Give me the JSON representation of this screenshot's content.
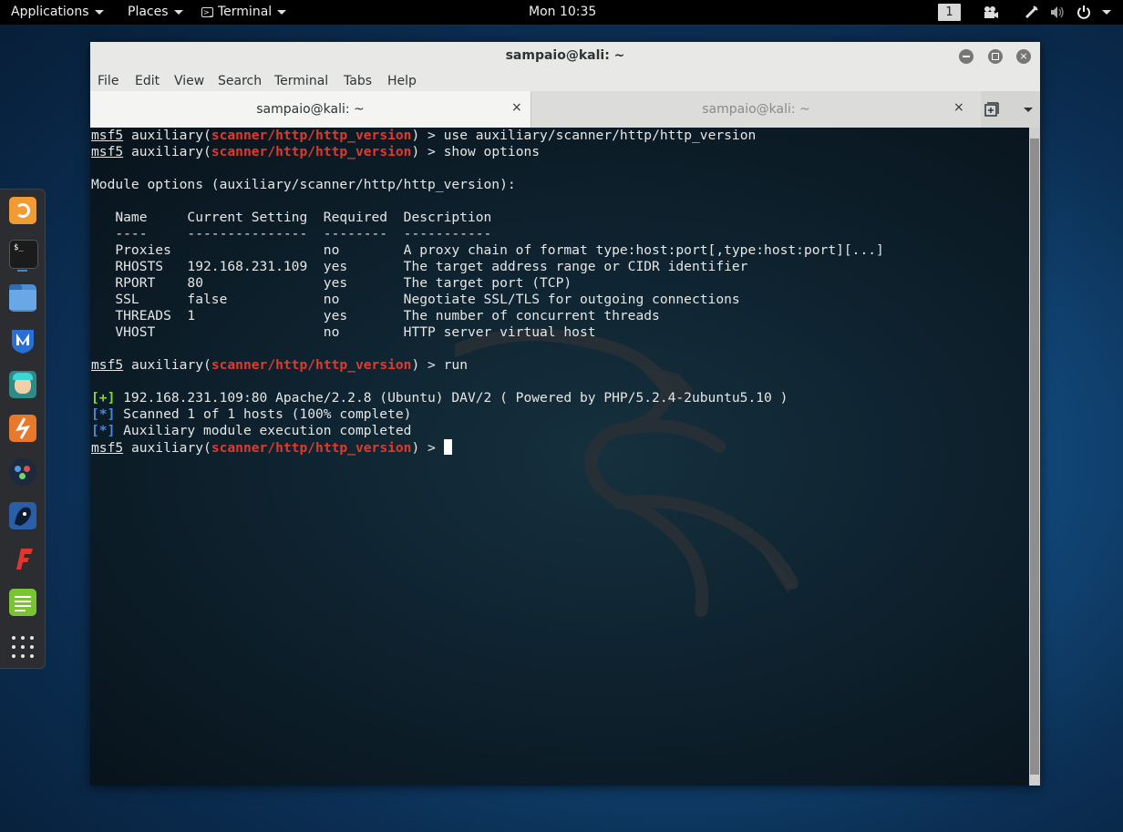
{
  "topbar": {
    "applications": "Applications",
    "places": "Places",
    "terminal": "Terminal",
    "clock": "Mon 10:35",
    "workspace": "1",
    "tray_icons": [
      "camera-icon",
      "pen-icon",
      "volume-icon",
      "power-icon"
    ]
  },
  "dock": {
    "apps": [
      "firefox-icon",
      "terminal-icon",
      "files-icon",
      "metasploit-icon",
      "armitage-icon",
      "burpsuite-icon",
      "maltego-icon",
      "beef-icon",
      "faraday-icon",
      "leafpad-icon",
      "show-apps-icon"
    ]
  },
  "window": {
    "title": "sampaio@kali: ~",
    "menu": [
      "File",
      "Edit",
      "View",
      "Search",
      "Terminal",
      "Tabs",
      "Help"
    ],
    "tabs": [
      {
        "label": "sampaio@kali: ~",
        "close": "×"
      },
      {
        "label": "sampaio@kali: ~",
        "close": "×"
      }
    ]
  },
  "terminal": {
    "prompt": {
      "user": "msf5",
      "mid": " auxiliary(",
      "module": "scanner/http/http_version",
      "end": ") > "
    },
    "cmd1": "use auxiliary/scanner/http/http_version",
    "cmd2": "show options",
    "module_options": "Module options (auxiliary/scanner/http/http_version):",
    "table_header": "   Name     Current Setting  Required  Description",
    "table_sep": "   ----     ---------------  --------  -----------",
    "rows": [
      "   Proxies                   no        A proxy chain of format type:host:port[,type:host:port][...]",
      "   RHOSTS   192.168.231.109  yes       The target address range or CIDR identifier",
      "   RPORT    80               yes       The target port (TCP)",
      "   SSL      false            no        Negotiate SSL/TLS for outgoing connections",
      "   THREADS  1                yes       The number of concurrent threads",
      "   VHOST                     no        HTTP server virtual host"
    ],
    "cmd3": "run",
    "out_plus_tag": "[+]",
    "out_plus": " 192.168.231.109:80 Apache/2.2.8 (Ubuntu) DAV/2 ( Powered by PHP/5.2.4-2ubuntu5.10 )",
    "out_star_tag": "[*]",
    "out_star1": " Scanned 1 of 1 hosts (100% complete)",
    "out_star2": " Auxiliary module execution completed"
  }
}
